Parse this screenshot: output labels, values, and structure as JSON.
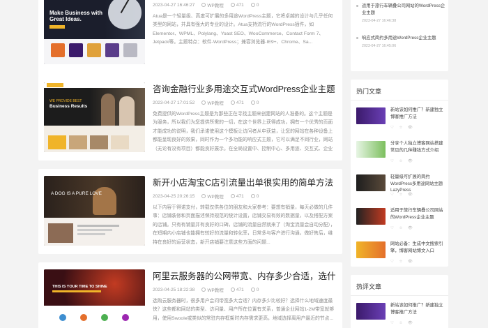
{
  "posts": [
    {
      "title": "",
      "date": "2023-04-27 16:46:27",
      "category": "WP教程",
      "views": "471",
      "comments": "0",
      "excerpt": "Atua是一个轻量级、高度可扩展的多用途WordPress主题，它将卓越的设计与几乎任何类型的网站，并具有强大的专业的设计。Atua支持流行的WordPress插件，如Elementor、WPML、Polylang、Yoast SEO、WooCommerce、Contact Form 7、Jetpack等。主题特点：软件-WordPress；兼容浏览器-IE9+、Chrome、Sa...",
      "thumb_text": "Make Business with Great Ideas."
    },
    {
      "title": "咨询金融行业多用途交互式WordPress企业主题",
      "date": "2023-04-27 17:01:52",
      "category": "WP教程",
      "views": "471",
      "comments": "0",
      "excerpt": "免费提供的WordPress主题是为那些正在寻找主题来创建网站的人准备的。这个主题是为服务，所以我们为您提供所需的一切，在这个世界上获得成功，拥有一个优秀的页面才能成功的说明，我们承诺使用这个模板让访问者从中获益，让您的网站在各种设备上都能呈现良好的效果，同时作为一个多功能的响应式主题，它可以满足不同行业，网站（无论有没有项目）都能良好展示。在全局设置中、控制中心、多用途、交互式、企业主题、等等网站，口碑优秀的主题一直受到欢迎...",
      "thumb_text": "Business Results"
    },
    {
      "title": "新开小店淘宝C店引流量出单很实用的简单方法",
      "date": "2023-04-25 20:26:15",
      "category": "WP教程",
      "views": "471",
      "comments": "0",
      "excerpt": "以下内容于得诺支付，转载仅供各位的朋友和大家参考：要想有销量，每天必做的几件事：店铺装修和页面描述保持规范的统计设置，店铺交易有效的数据量，以及搭配方案的店铺。只有有销量并有良好的口碑，店铺的流量自然就来了（淘宝流量会自动分配），在短期内小店铺也能拥有较好的流量和转化率，日常多与客户进行沟通，做好售后，维持在良好的运营状态，新开店铺要注意这些方面的问题...",
      "thumb_text": "A DOG IS A PURE LOVE"
    },
    {
      "title": "阿里云服务器的公网带宽、内存多少合适，选什么地域",
      "date": "2023-04-25 18:22:38",
      "category": "WP教程",
      "views": "471",
      "comments": "0",
      "excerpt": "选购云服务器时，很多用户会问带宽多大合适？内存多少比较好？选择什么地域速度最快？这些都和网站的类型、访问量、用户所在位置有关系，普通企业网站1-2M带宽就够用，使用Swoole或类似的常驻内存框架时内存需求更高，地域选择离用户最近的节点...",
      "thumb_text": "THIS IS YOUR TIME TO SHINE"
    }
  ],
  "sidebar": {
    "top_list": [
      {
        "text": "适用于旅行车辆叠公司网站的WordPress企业主题",
        "date": "2023-04-27 16:46:38"
      },
      {
        "text": "响应式简约多用途WordPress企业主题",
        "date": "2023-04-27 16:45:06"
      }
    ],
    "hot": {
      "title": "热门文章",
      "items": [
        {
          "text": "新站该如何推广？新建独立博客推广方法",
          "stats": "♡ ☆ 👁"
        },
        {
          "text": "分享个人独立博客网站搭建常见的几种赚钱方式介绍",
          "stats": "♡ ☆ 👁"
        },
        {
          "text": "轻量级可扩展的简约WordPress多用途网站主题LazyPress",
          "stats": "♡ ☆ 👁"
        },
        {
          "text": "适用于旅行车辆叠公司网站的WordPress企业主题",
          "stats": "♡ ☆ 👁"
        },
        {
          "text": "网站必备：生成中文搜索引擎，博客网站博文入口",
          "stats": "♡ ☆ 👁"
        }
      ]
    },
    "comments": {
      "title": "热评文章",
      "items": [
        {
          "text": "新站该如何推广？新建独立博客推广方法",
          "stats": "♡ ☆ 👁"
        }
      ]
    }
  },
  "colors": {
    "purple": "#3b1a6b",
    "gold": "#f0b429",
    "dark": "#1e1e1e",
    "red": "#c23b22"
  }
}
